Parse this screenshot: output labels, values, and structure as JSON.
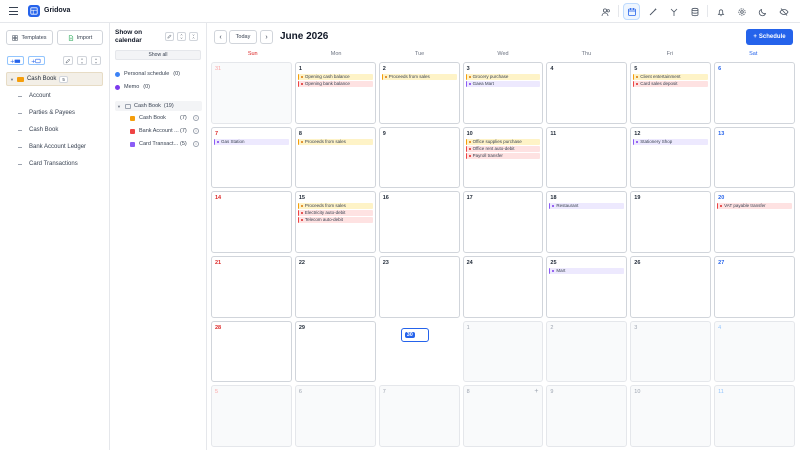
{
  "app": {
    "title": "Gridova"
  },
  "sidebar": {
    "templates_label": "Templates",
    "import_label": "Import",
    "root": {
      "label": "Cash Book",
      "count": "5"
    },
    "items": [
      {
        "label": "Account"
      },
      {
        "label": "Parties & Payees"
      },
      {
        "label": "Cash Book"
      },
      {
        "label": "Bank Account Ledger"
      },
      {
        "label": "Card Transactions"
      }
    ]
  },
  "filter": {
    "title": "Show on calendar",
    "show_all": "Show all",
    "personal": {
      "label": "Personal schedule",
      "count": "(0)"
    },
    "memo": {
      "label": "Memo",
      "count": "(0)"
    },
    "group": {
      "label": "Cash Book",
      "count": "(19)"
    },
    "subs": [
      {
        "label": "Cash Book",
        "count": "(7)",
        "color": "#f59e0b"
      },
      {
        "label": "Bank Account ...",
        "count": "(7)",
        "color": "#ef4444"
      },
      {
        "label": "Card Transact...",
        "count": "(5)",
        "color": "#8b5cf6"
      }
    ]
  },
  "calendar": {
    "month_label": "June 2026",
    "today_label": "Today",
    "schedule_label": "Schedule",
    "weekdays": [
      "Sun",
      "Mon",
      "Tue",
      "Wed",
      "Thu",
      "Fri",
      "Sat"
    ],
    "weeks": [
      [
        {
          "day": "31",
          "other": true,
          "events": []
        },
        {
          "day": "1",
          "events": [
            {
              "text": "Opening cash balance",
              "type": "cash"
            },
            {
              "text": "Opening bank balance",
              "type": "bank"
            }
          ]
        },
        {
          "day": "2",
          "events": [
            {
              "text": "Proceeds from sales",
              "type": "cash"
            }
          ]
        },
        {
          "day": "3",
          "events": [
            {
              "text": "Grocery purchase",
              "type": "cash"
            },
            {
              "text": "Gaea Mart",
              "type": "card"
            }
          ]
        },
        {
          "day": "4",
          "events": []
        },
        {
          "day": "5",
          "events": [
            {
              "text": "Client entertainment",
              "type": "cash"
            },
            {
              "text": "Card sales deposit",
              "type": "bank"
            }
          ]
        },
        {
          "day": "6",
          "events": []
        }
      ],
      [
        {
          "day": "7",
          "events": [
            {
              "text": "Gas Station",
              "type": "card"
            }
          ]
        },
        {
          "day": "8",
          "events": [
            {
              "text": "Proceeds from sales",
              "type": "cash"
            }
          ]
        },
        {
          "day": "9",
          "events": []
        },
        {
          "day": "10",
          "events": [
            {
              "text": "Office supplies purchase",
              "type": "cash"
            },
            {
              "text": "Office rent auto-debit",
              "type": "bank"
            },
            {
              "text": "Payroll transfer",
              "type": "bank"
            }
          ]
        },
        {
          "day": "11",
          "events": []
        },
        {
          "day": "12",
          "events": [
            {
              "text": "Stationery Shop",
              "type": "card"
            }
          ]
        },
        {
          "day": "13",
          "events": []
        }
      ],
      [
        {
          "day": "14",
          "events": []
        },
        {
          "day": "15",
          "events": [
            {
              "text": "Proceeds from sales",
              "type": "cash"
            },
            {
              "text": "Electricity auto-debit",
              "type": "bank"
            },
            {
              "text": "Telecom auto-debit",
              "type": "bank"
            }
          ]
        },
        {
          "day": "16",
          "events": []
        },
        {
          "day": "17",
          "events": []
        },
        {
          "day": "18",
          "events": [
            {
              "text": "Restaurant",
              "type": "card"
            }
          ]
        },
        {
          "day": "19",
          "events": []
        },
        {
          "day": "20",
          "events": [
            {
              "text": "VAT payable transfer",
              "type": "bank"
            }
          ]
        }
      ],
      [
        {
          "day": "21",
          "events": []
        },
        {
          "day": "22",
          "events": []
        },
        {
          "day": "23",
          "events": []
        },
        {
          "day": "24",
          "events": []
        },
        {
          "day": "25",
          "events": [
            {
              "text": "Mart",
              "type": "card"
            }
          ]
        },
        {
          "day": "26",
          "events": []
        },
        {
          "day": "27",
          "events": []
        }
      ],
      [
        {
          "day": "28",
          "events": []
        },
        {
          "day": "29",
          "events": []
        },
        {
          "day": "30",
          "today": true,
          "events": []
        },
        {
          "day": "1",
          "other": true,
          "events": []
        },
        {
          "day": "2",
          "other": true,
          "events": []
        },
        {
          "day": "3",
          "other": true,
          "events": []
        },
        {
          "day": "4",
          "other": true,
          "events": []
        }
      ],
      [
        {
          "day": "5",
          "other": true,
          "events": []
        },
        {
          "day": "6",
          "other": true,
          "events": []
        },
        {
          "day": "7",
          "other": true,
          "events": []
        },
        {
          "day": "8",
          "other": true,
          "plus": "+",
          "events": []
        },
        {
          "day": "9",
          "other": true,
          "events": []
        },
        {
          "day": "10",
          "other": true,
          "events": []
        },
        {
          "day": "11",
          "other": true,
          "events": []
        }
      ]
    ]
  }
}
